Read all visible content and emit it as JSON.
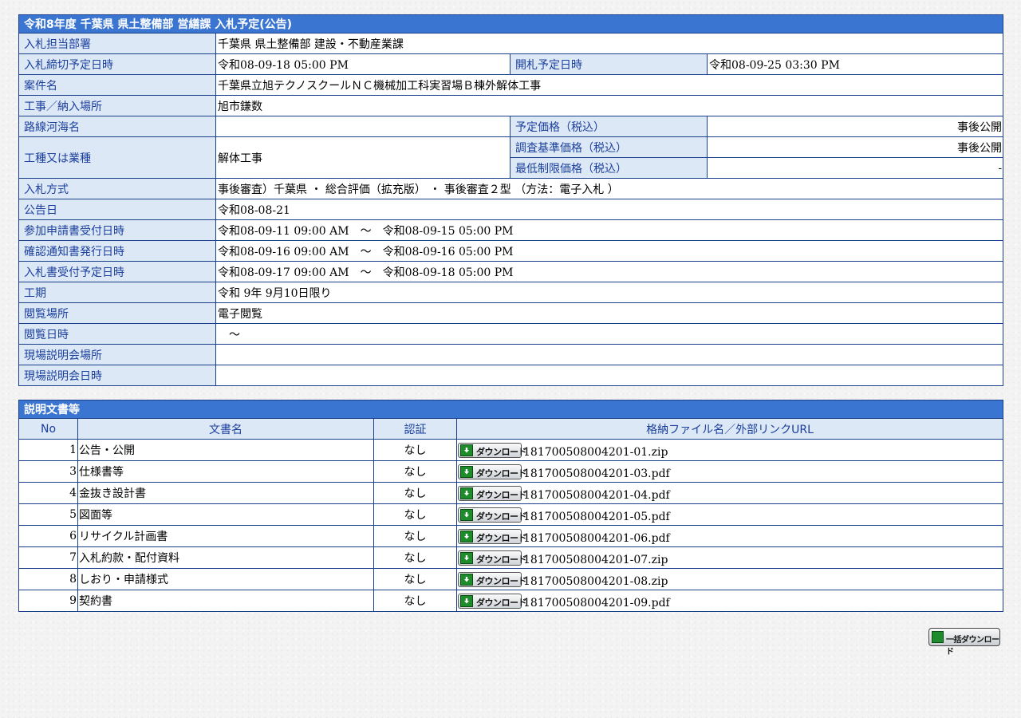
{
  "info": {
    "title": "令和8年度 千葉県 県土整備部 営繕課 入札予定(公告)",
    "labels": {
      "dept": "入札担当部署",
      "deadline": "入札締切予定日時",
      "opening": "開札予定日時",
      "project": "案件名",
      "place": "工事／納入場所",
      "route": "路線河海名",
      "planned_price": "予定価格（税込）",
      "category": "工種又は業種",
      "survey_price": "調査基準価格（税込）",
      "min_price": "最低制限価格（税込）",
      "method": "入札方式",
      "announce": "公告日",
      "apply": "参加申請書受付日時",
      "confirm": "確認通知書発行日時",
      "receive": "入札書受付予定日時",
      "period": "工期",
      "view_place": "閲覧場所",
      "view_time": "閲覧日時",
      "site_place": "現場説明会場所",
      "site_time": "現場説明会日時"
    },
    "values": {
      "dept": "千葉県 県土整備部 建設・不動産業課",
      "deadline": "令和08-09-18 05:00 PM",
      "opening": "令和08-09-25 03:30 PM",
      "project": "千葉県立旭テクノスクールＮＣ機械加工科実習場Ｂ棟外解体工事",
      "place": "旭市鎌数",
      "route": "",
      "planned_price": "事後公開",
      "category": "解体工事",
      "survey_price": "事後公開",
      "min_price": "-",
      "method": "事後審査）千葉県 ・ 総合評価（拡充版） ・ 事後審査２型 （方法：電子入札 ）",
      "announce": "令和08-08-21",
      "apply": "令和08-09-11 09:00 AM　～　令和08-09-15 05:00 PM",
      "confirm": "令和08-09-16 09:00 AM　～　令和08-09-16 05:00 PM",
      "receive": "令和08-09-17 09:00 AM　～　令和08-09-18 05:00 PM",
      "period": "令和 9年 9月10日限り",
      "view_place": "電子閲覧",
      "view_time": "　～",
      "site_place": "",
      "site_time": ""
    }
  },
  "docs": {
    "title": "説明文書等",
    "headers": {
      "no": "No",
      "name": "文書名",
      "cert": "認証",
      "file": "格納ファイル名／外部リンクURL"
    },
    "download_label": "ダウンロード",
    "rows": [
      {
        "no": "1",
        "name": "公告・公開",
        "cert": "なし",
        "file": "181700508004201-01.zip"
      },
      {
        "no": "3",
        "name": "仕様書等",
        "cert": "なし",
        "file": "181700508004201-03.pdf"
      },
      {
        "no": "4",
        "name": "金抜き設計書",
        "cert": "なし",
        "file": "181700508004201-04.pdf"
      },
      {
        "no": "5",
        "name": "図面等",
        "cert": "なし",
        "file": "181700508004201-05.pdf"
      },
      {
        "no": "6",
        "name": "リサイクル計画書",
        "cert": "なし",
        "file": "181700508004201-06.pdf"
      },
      {
        "no": "7",
        "name": "入札約款・配付資料",
        "cert": "なし",
        "file": "181700508004201-07.zip"
      },
      {
        "no": "8",
        "name": "しおり・申請様式",
        "cert": "なし",
        "file": "181700508004201-08.zip"
      },
      {
        "no": "9",
        "name": "契約書",
        "cert": "なし",
        "file": "181700508004201-09.pdf"
      }
    ]
  },
  "bulk_download_label": "一括ダウンロード",
  "icons": {
    "download": "download-icon"
  },
  "colors": {
    "header_bg": "#3a76d1",
    "label_bg": "#dde8f7",
    "label_text": "#1a3f9c",
    "border": "#1a3f8c"
  }
}
